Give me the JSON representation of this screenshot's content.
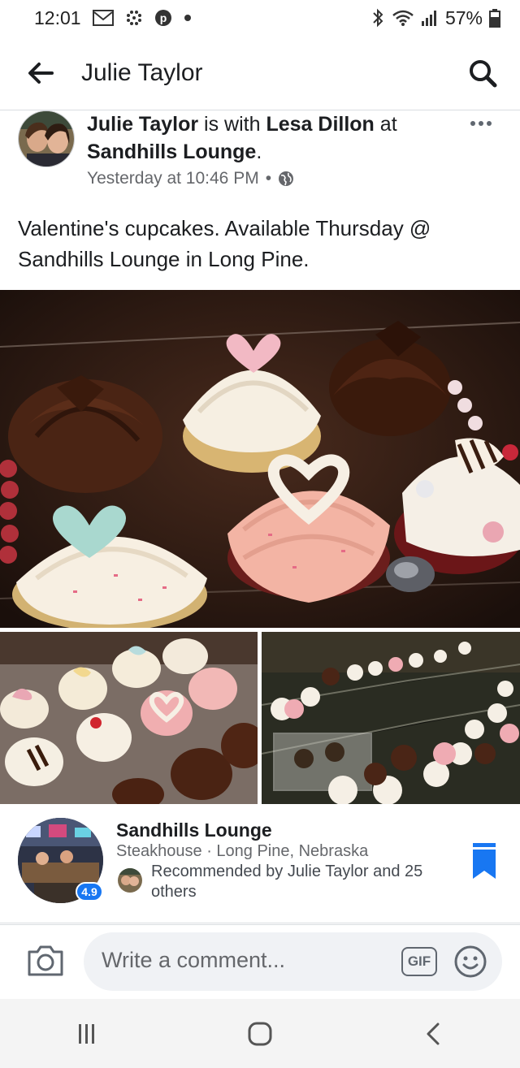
{
  "status_bar": {
    "time": "12:01",
    "battery": "57%",
    "icons_left": [
      "gmail-icon",
      "slack-icon",
      "pinterest-icon",
      "dot-icon"
    ],
    "icons_right": [
      "bluetooth-icon",
      "wifi-icon",
      "signal-icon",
      "battery-icon"
    ]
  },
  "header": {
    "title": "Julie Taylor",
    "back_icon": "arrow-left-icon",
    "search_icon": "search-icon"
  },
  "post": {
    "author": "Julie Taylor",
    "with_text": "is with",
    "tagged": "Lesa Dillon",
    "at_text": "at",
    "place": "Sandhills Lounge",
    "period": ".",
    "timestamp": "Yesterday at 10:46 PM",
    "separator": "•",
    "privacy_icon": "globe-icon",
    "text": "Valentine's cupcakes. Available Thursday @ Sandhills Lounge in Long Pine."
  },
  "place_card": {
    "name": "Sandhills Lounge",
    "subtitle": "Steakhouse · Long Pine, Nebraska",
    "recommendation": "Recommended by Julie Taylor and 25 others",
    "rating": "4.9",
    "bookmark_color": "#1877f2"
  },
  "comment_bar": {
    "placeholder": "Write a comment...",
    "gif_label": "GIF"
  },
  "colors": {
    "accent": "#1877f2",
    "secondary_text": "#65676b"
  }
}
